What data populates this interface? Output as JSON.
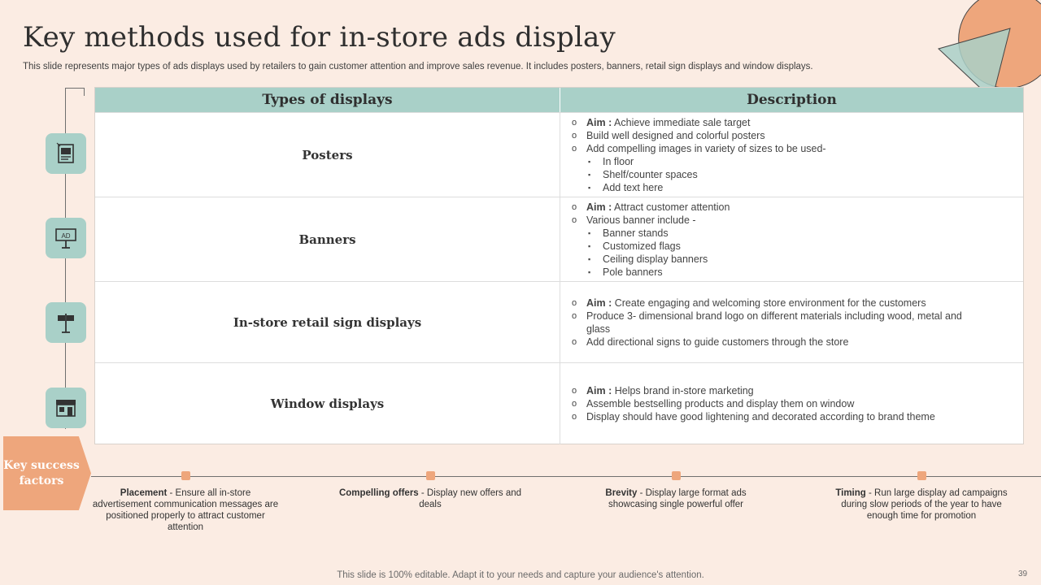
{
  "title": "Key methods used for in-store ads display",
  "subtitle": "This slide represents major types of ads displays used by retailers to gain customer attention and improve sales revenue. It includes posters, banners, retail sign displays and window displays.",
  "table": {
    "headers": [
      "Types of displays",
      "Description"
    ],
    "rows": [
      {
        "type": "Posters",
        "icon": "poster-icon",
        "items": [
          {
            "level": 1,
            "bold": "Aim :",
            "text": " Achieve immediate sale target"
          },
          {
            "level": 1,
            "bold": "",
            "text": "Build well designed and colorful posters"
          },
          {
            "level": 1,
            "bold": "",
            "text": "Add compelling images in variety of sizes to be used-"
          },
          {
            "level": 2,
            "bold": "",
            "text": "In floor"
          },
          {
            "level": 2,
            "bold": "",
            "text": "Shelf/counter spaces"
          },
          {
            "level": 2,
            "bold": "",
            "text": "Add text here"
          }
        ]
      },
      {
        "type": "Banners",
        "icon": "billboard-ad-icon",
        "items": [
          {
            "level": 1,
            "bold": "Aim :",
            "text": " Attract customer attention"
          },
          {
            "level": 1,
            "bold": "",
            "text": "Various banner include -"
          },
          {
            "level": 2,
            "bold": "",
            "text": "Banner stands"
          },
          {
            "level": 2,
            "bold": "",
            "text": "Customized flags"
          },
          {
            "level": 2,
            "bold": "",
            "text": "Ceiling display banners"
          },
          {
            "level": 2,
            "bold": "",
            "text": "Pole banners"
          }
        ]
      },
      {
        "type": "In-store retail sign displays",
        "icon": "directional-sign-icon",
        "items": [
          {
            "level": 1,
            "bold": "Aim :",
            "text": " Create engaging and welcoming store environment for the customers"
          },
          {
            "level": 1,
            "bold": "",
            "text": "Produce 3- dimensional brand logo on different materials including wood, metal and glass"
          },
          {
            "level": 1,
            "bold": "",
            "text": "Add directional signs to guide customers through the store"
          }
        ]
      },
      {
        "type": "Window displays",
        "icon": "storefront-icon",
        "items": [
          {
            "level": 1,
            "bold": "Aim :",
            "text": " Helps brand in-store marketing"
          },
          {
            "level": 1,
            "bold": "",
            "text": "Assemble bestselling products and display them on window"
          },
          {
            "level": 1,
            "bold": "",
            "text": "Display should have good lightening and decorated according to brand theme"
          }
        ]
      }
    ]
  },
  "ksf_label": "Key success factors",
  "factors": [
    {
      "bold": "Placement",
      "text": " - Ensure all in-store advertisement communication messages are positioned properly to attract customer attention"
    },
    {
      "bold": "Compelling offers",
      "text": " - Display new offers and deals"
    },
    {
      "bold": "Brevity",
      "text": " - Display large format ads showcasing single powerful offer"
    },
    {
      "bold": "Timing",
      "text": " - Run large display ad campaigns during slow periods of the year to have enough time for promotion"
    }
  ],
  "footer": "This slide is 100% editable. Adapt it to your needs and capture your audience's attention.",
  "page_number": "39",
  "colors": {
    "background": "#fbece3",
    "teal": "#a9d0c8",
    "orange": "#eea67c"
  },
  "icon_labels": {
    "billboard": "AD"
  }
}
